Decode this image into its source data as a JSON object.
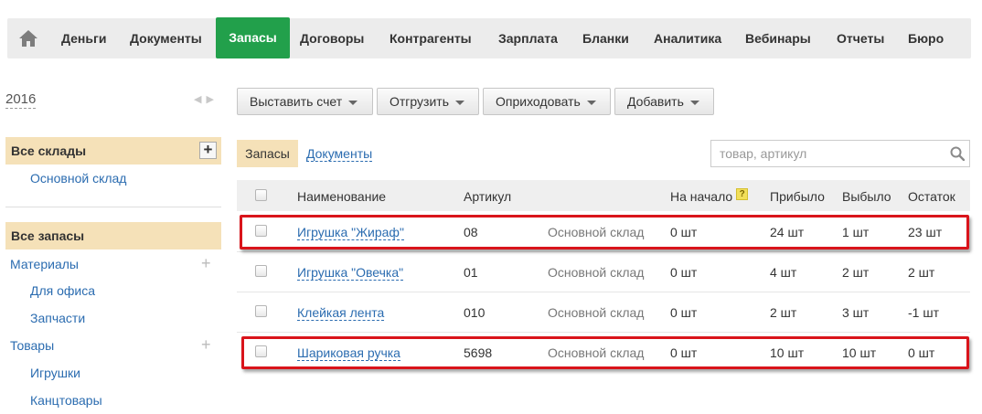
{
  "nav": {
    "items": [
      "Деньги",
      "Документы",
      "Запасы",
      "Договоры",
      "Контрагенты",
      "Зарплата",
      "Бланки",
      "Аналитика",
      "Вебинары",
      "Отчеты",
      "Бюро"
    ],
    "active": "Запасы",
    "home_icon": "home-icon"
  },
  "sidebar": {
    "year": "2016",
    "warehouses_title": "Все склады",
    "warehouses": [
      "Основной склад"
    ],
    "stock_title": "Все запасы",
    "categories": {
      "materials": "Материалы",
      "materials_children": [
        "Для офиса",
        "Запчасти"
      ],
      "goods": "Товары",
      "goods_children": [
        "Игрушки",
        "Канцтовары"
      ]
    }
  },
  "toolbar": {
    "buttons": [
      "Выставить счет",
      "Отгрузить",
      "Оприходовать",
      "Добавить"
    ]
  },
  "tabs": {
    "active": "Запасы",
    "other": "Документы"
  },
  "search": {
    "placeholder": "товар, артикул",
    "value": ""
  },
  "table": {
    "headers": {
      "name": "Наименование",
      "article": "Артикул",
      "start": "На начало",
      "start_help": "?",
      "income": "Прибыло",
      "outcome": "Выбыло",
      "balance": "Остаток"
    },
    "rows": [
      {
        "name": "Игрушка \"Жираф\"",
        "article": "08",
        "warehouse": "Основной склад",
        "start": "0 шт",
        "income": "24 шт",
        "outcome": "1 шт",
        "balance": "23 шт",
        "highlighted": true
      },
      {
        "name": "Игрушка \"Овечка\"",
        "article": "01",
        "warehouse": "Основной склад",
        "start": "0 шт",
        "income": "4 шт",
        "outcome": "2 шт",
        "balance": "2 шт",
        "highlighted": false
      },
      {
        "name": "Клейкая лента",
        "article": "010",
        "warehouse": "Основной склад",
        "start": "0 шт",
        "income": "2 шт",
        "outcome": "3 шт",
        "balance": "-1 шт",
        "highlighted": false
      },
      {
        "name": "Шариковая ручка",
        "article": "5698",
        "warehouse": "Основной склад",
        "start": "0 шт",
        "income": "10 шт",
        "outcome": "10 шт",
        "balance": "0 шт",
        "highlighted": true
      }
    ]
  },
  "colors": {
    "active_nav": "#22a04b",
    "sidebar_highlight": "#f5e1b8",
    "link": "#2b6cb0",
    "highlight_frame": "#d9141b"
  }
}
